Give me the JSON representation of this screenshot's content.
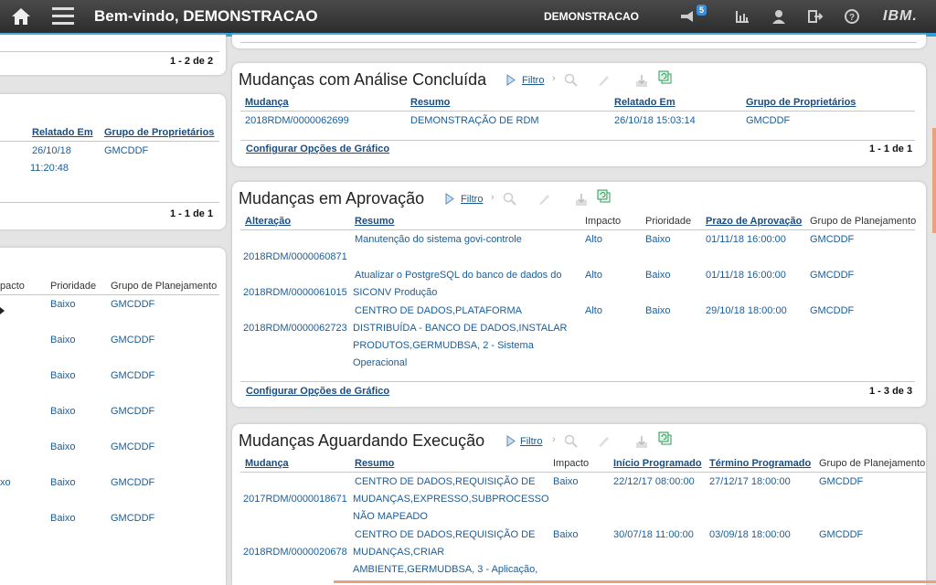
{
  "topbar": {
    "title": "Bem-vindo, DEMONSTRACAO",
    "user": "DEMONSTRACAO",
    "notification_count": "5",
    "brand": "IBM."
  },
  "left": {
    "p1": {
      "pager": "1 - 2 de 2"
    },
    "p2": {
      "headers": [
        "Relatado Em",
        "Grupo de Proprietários"
      ],
      "row": {
        "date": "26/10/18",
        "time": "11:20:48",
        "group": "GMCDDF"
      },
      "pager": "1 - 1 de 1"
    },
    "p3": {
      "headers": [
        "pacto",
        "Prioridade",
        "Grupo de Planejamento"
      ],
      "rows": [
        {
          "impact": "",
          "priority": "Baixo",
          "group": "GMCDDF"
        },
        {
          "impact": "",
          "priority": "Baixo",
          "group": "GMCDDF"
        },
        {
          "impact": "",
          "priority": "Baixo",
          "group": "GMCDDF"
        },
        {
          "impact": "",
          "priority": "Baixo",
          "group": "GMCDDF"
        },
        {
          "impact": "",
          "priority": "Baixo",
          "group": "GMCDDF"
        },
        {
          "impact": "xo",
          "priority": "Baixo",
          "group": "GMCDDF"
        },
        {
          "impact": "",
          "priority": "Baixo",
          "group": "GMCDDF"
        }
      ]
    }
  },
  "concluida": {
    "title": "Mudanças com Análise Concluída",
    "filtro": "Filtro",
    "headers": [
      "Mudança",
      "Resumo",
      "Relatado Em",
      "Grupo de Proprietários"
    ],
    "rows": [
      {
        "id": "2018RDM/0000062699",
        "resumo": "DEMONSTRAÇÃO DE RDM",
        "date": "26/10/18 15:03:14",
        "group": "GMCDDF"
      }
    ],
    "config": "Configurar Opções de Gráfico",
    "pager": "1 - 1 de 1"
  },
  "aprovacao": {
    "title": "Mudanças em Aprovação",
    "filtro": "Filtro",
    "headers": [
      "Alteração",
      "Resumo",
      "Impacto",
      "Prioridade",
      "Prazo de Aprovação",
      "Grupo de Planejamento"
    ],
    "rows": [
      {
        "id": "2018RDM/0000060871",
        "resumo1": "Manutenção do sistema govi-controle",
        "resumo2": "",
        "resumo3": "",
        "resumo4": "",
        "impact": "Alto",
        "priority": "Baixo",
        "date": "01/11/18 16:00:00",
        "group": "GMCDDF"
      },
      {
        "id": "2018RDM/0000061015",
        "resumo1": "Atualizar o PostgreSQL do banco de dados do",
        "resumo2": "SICONV Produção",
        "resumo3": "",
        "resumo4": "",
        "impact": "Alto",
        "priority": "Baixo",
        "date": "01/11/18 16:00:00",
        "group": "GMCDDF"
      },
      {
        "id": "2018RDM/0000062723",
        "resumo1": "CENTRO DE DADOS,PLATAFORMA",
        "resumo2": "DISTRIBUÍDA - BANCO DE DADOS,INSTALAR",
        "resumo3": "PRODUTOS,GERMUDBSA, 2 - Sistema",
        "resumo4": "Operacional",
        "impact": "Alto",
        "priority": "Baixo",
        "date": "29/10/18 18:00:00",
        "group": "GMCDDF"
      }
    ],
    "config": "Configurar Opções de Gráfico",
    "pager": "1 - 3 de 3"
  },
  "execucao": {
    "title": "Mudanças Aguardando Execução",
    "filtro": "Filtro",
    "headers": [
      "Mudança",
      "Resumo",
      "Impacto",
      "Início Programado",
      "Término Programado",
      "Grupo de Planejamento"
    ],
    "rows": [
      {
        "id": "2017RDM/0000018671",
        "resumo1": "CENTRO DE DADOS,REQUISIÇÃO DE",
        "resumo2": "MUDANÇAS,EXPRESSO,SUBPROCESSO",
        "resumo3": "NÃO MAPEADO",
        "impact": "Baixo",
        "start": "22/12/17 08:00:00",
        "end": "27/12/17 18:00:00",
        "group": "GMCDDF"
      },
      {
        "id": "2018RDM/0000020678",
        "resumo1": "CENTRO DE DADOS,REQUISIÇÃO DE",
        "resumo2": "MUDANÇAS,CRIAR",
        "resumo3": "AMBIENTE,GERMUDBSA, 3 - Aplicação,",
        "impact": "Baixo",
        "start": "30/07/18 11:00:00",
        "end": "03/09/18 18:00:00",
        "group": "GMCDDF"
      }
    ]
  }
}
